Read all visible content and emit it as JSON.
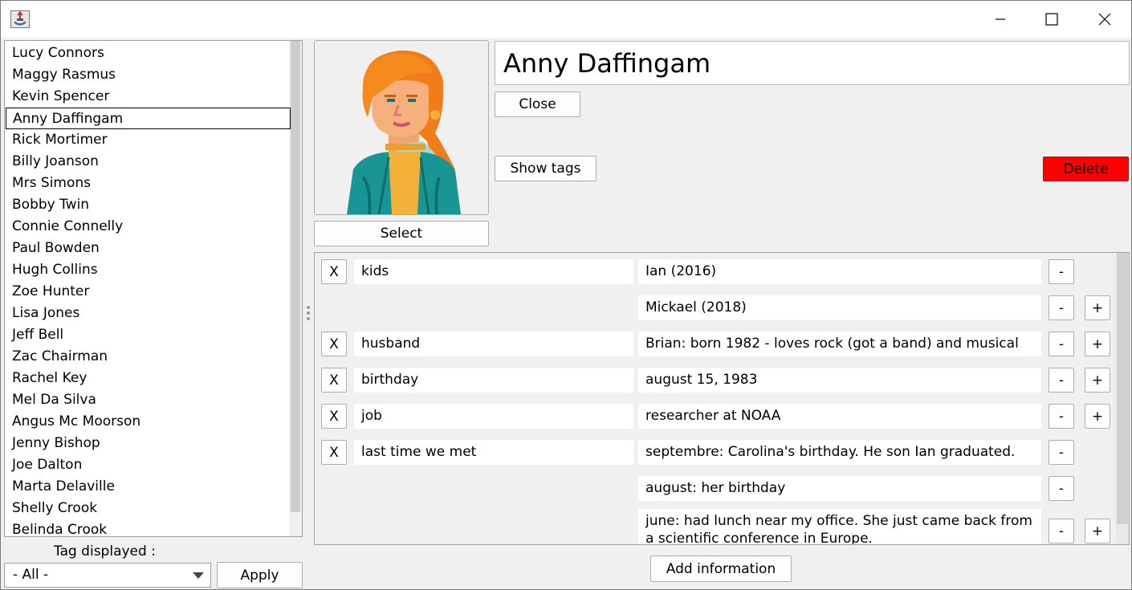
{
  "window": {
    "icon": "java-app-icon",
    "controls": [
      "minimize-icon",
      "maximize-icon",
      "close-icon"
    ]
  },
  "contacts": [
    "Lucy Connors",
    "Maggy Rasmus",
    "Kevin Spencer",
    "Anny Daffingam",
    "Rick Mortimer",
    "Billy Joanson",
    "Mrs Simons",
    "Bobby Twin",
    "Connie Connelly",
    "Paul Bowden",
    "Hugh Collins",
    "Zoe Hunter",
    "Lisa Jones",
    "Jeff Bell",
    "Zac Chairman",
    "Rachel Key",
    "Mel Da Silva",
    "Angus Mc Moorson",
    "Jenny Bishop",
    "Joe Dalton",
    "Marta Delaville",
    "Shelly Crook",
    "Belinda Crook"
  ],
  "selected_contact": "Anny Daffingam",
  "filter": {
    "label": "Tag displayed :",
    "value": "- All -",
    "apply_label": "Apply"
  },
  "detail": {
    "name": "Anny Daffingam",
    "close_label": "Close",
    "show_tags_label": "Show tags",
    "delete_label": "Delete",
    "delete_color": "#ff0000",
    "select_label": "Select",
    "avatar_icon": "woman-avatar-icon"
  },
  "info": {
    "remove_symbol": "X",
    "minus_symbol": "-",
    "plus_symbol": "+",
    "rows": [
      {
        "tag": "kids",
        "value": "Ian (2016)"
      },
      {
        "tag": "",
        "value": "Mickael (2018)"
      },
      {
        "tag": "husband",
        "value": "Brian: born 1982 - loves rock (got a band) and musical"
      },
      {
        "tag": "birthday",
        "value": "august 15, 1983"
      },
      {
        "tag": "job",
        "value": "researcher at NOAA"
      },
      {
        "tag": "last time we met",
        "value": "septembre: Carolina's birthday. He son Ian graduated."
      },
      {
        "tag": "",
        "value": "august: her birthday"
      },
      {
        "tag": "",
        "value": "june: had lunch near my office. She just came back from a scientific conference in Europe."
      }
    ],
    "add_label": "Add information"
  }
}
